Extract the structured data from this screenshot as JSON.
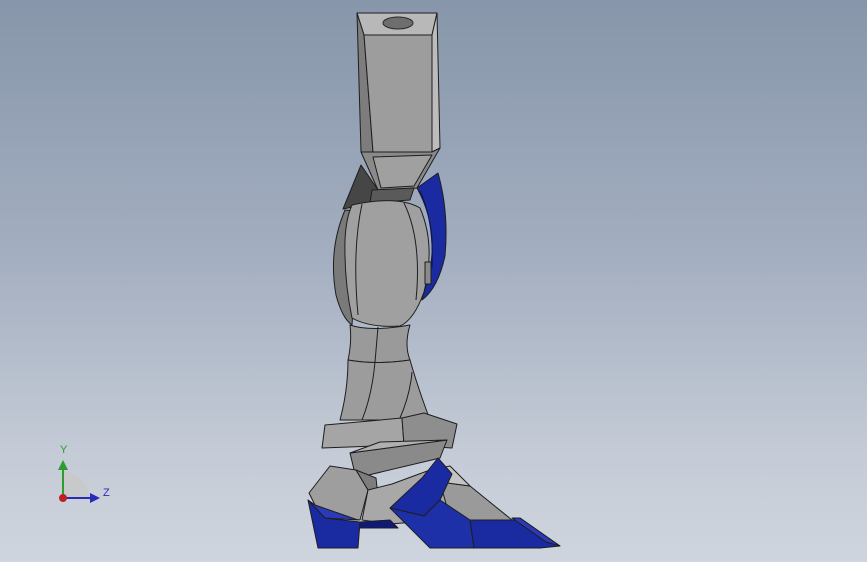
{
  "viewport": {
    "background_top": "#8796aa",
    "background_bottom": "#cfd5de"
  },
  "model": {
    "part_name": "robot-leg",
    "colors": {
      "gray_light": "#a5a5a5",
      "gray_mid": "#8e8e8e",
      "gray_dark": "#6a6a6a",
      "joint_dark": "#4a4a4a",
      "blue_armor": "#1a2aa0",
      "blue_dark": "#0f1a78",
      "edge": "#1e1e1e"
    }
  },
  "triad": {
    "y_label": "Y",
    "z_label": "Z",
    "y_color": "#2e9b2e",
    "z_color": "#2a2ab8",
    "origin_color": "#c0201e"
  }
}
